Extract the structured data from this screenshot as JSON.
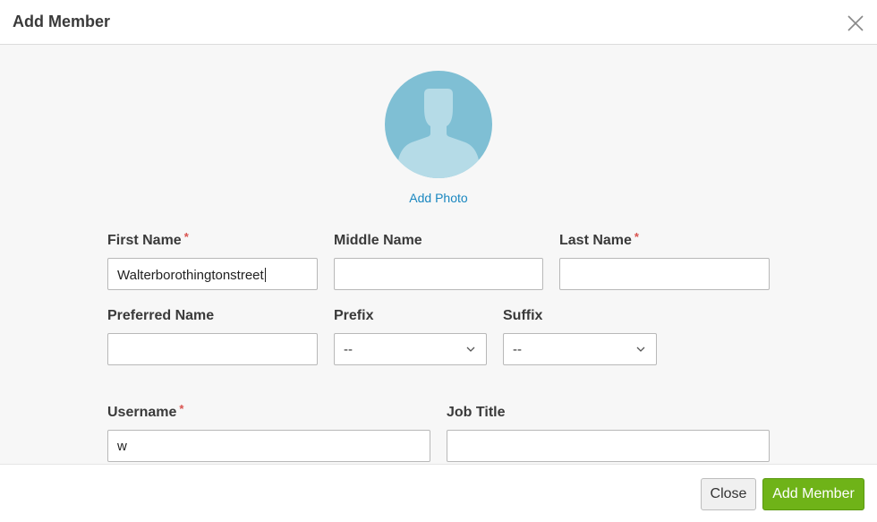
{
  "dialog": {
    "title": "Add Member"
  },
  "photo": {
    "add_label": "Add Photo"
  },
  "form": {
    "first_name": {
      "label": "First Name",
      "required_mark": "*",
      "value": "Walterborothingtonstreet"
    },
    "middle_name": {
      "label": "Middle Name",
      "value": ""
    },
    "last_name": {
      "label": "Last Name",
      "required_mark": "*",
      "value": ""
    },
    "preferred_name": {
      "label": "Preferred Name",
      "value": ""
    },
    "prefix": {
      "label": "Prefix",
      "selected": "--"
    },
    "suffix": {
      "label": "Suffix",
      "selected": "--"
    },
    "username": {
      "label": "Username",
      "required_mark": "*",
      "value": "w"
    },
    "job_title": {
      "label": "Job Title",
      "value": ""
    }
  },
  "footer": {
    "close_label": "Close",
    "add_label": "Add Member"
  },
  "colors": {
    "accent_green": "#6fb318",
    "link_blue": "#1a87c0",
    "avatar_bg": "#7fbfd4",
    "required_red": "#d9534f"
  }
}
